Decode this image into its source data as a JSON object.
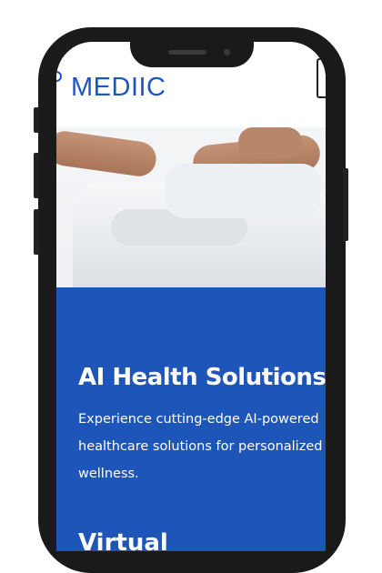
{
  "header": {
    "logo_text": "MEDIIC",
    "menu_icon": "menu-icon"
  },
  "hero": {
    "image_alt": "doctor-arms-crossed"
  },
  "section": {
    "title": "AI Health Solutions",
    "description": "Experience cutting-edge AI-powered\nhealthcare solutions for personalized\nwellness.",
    "next_title": "Virtual"
  },
  "colors": {
    "brand": "#1e55c4",
    "section_bg": "#1e55b8",
    "text_on_blue": "#ffffff"
  }
}
